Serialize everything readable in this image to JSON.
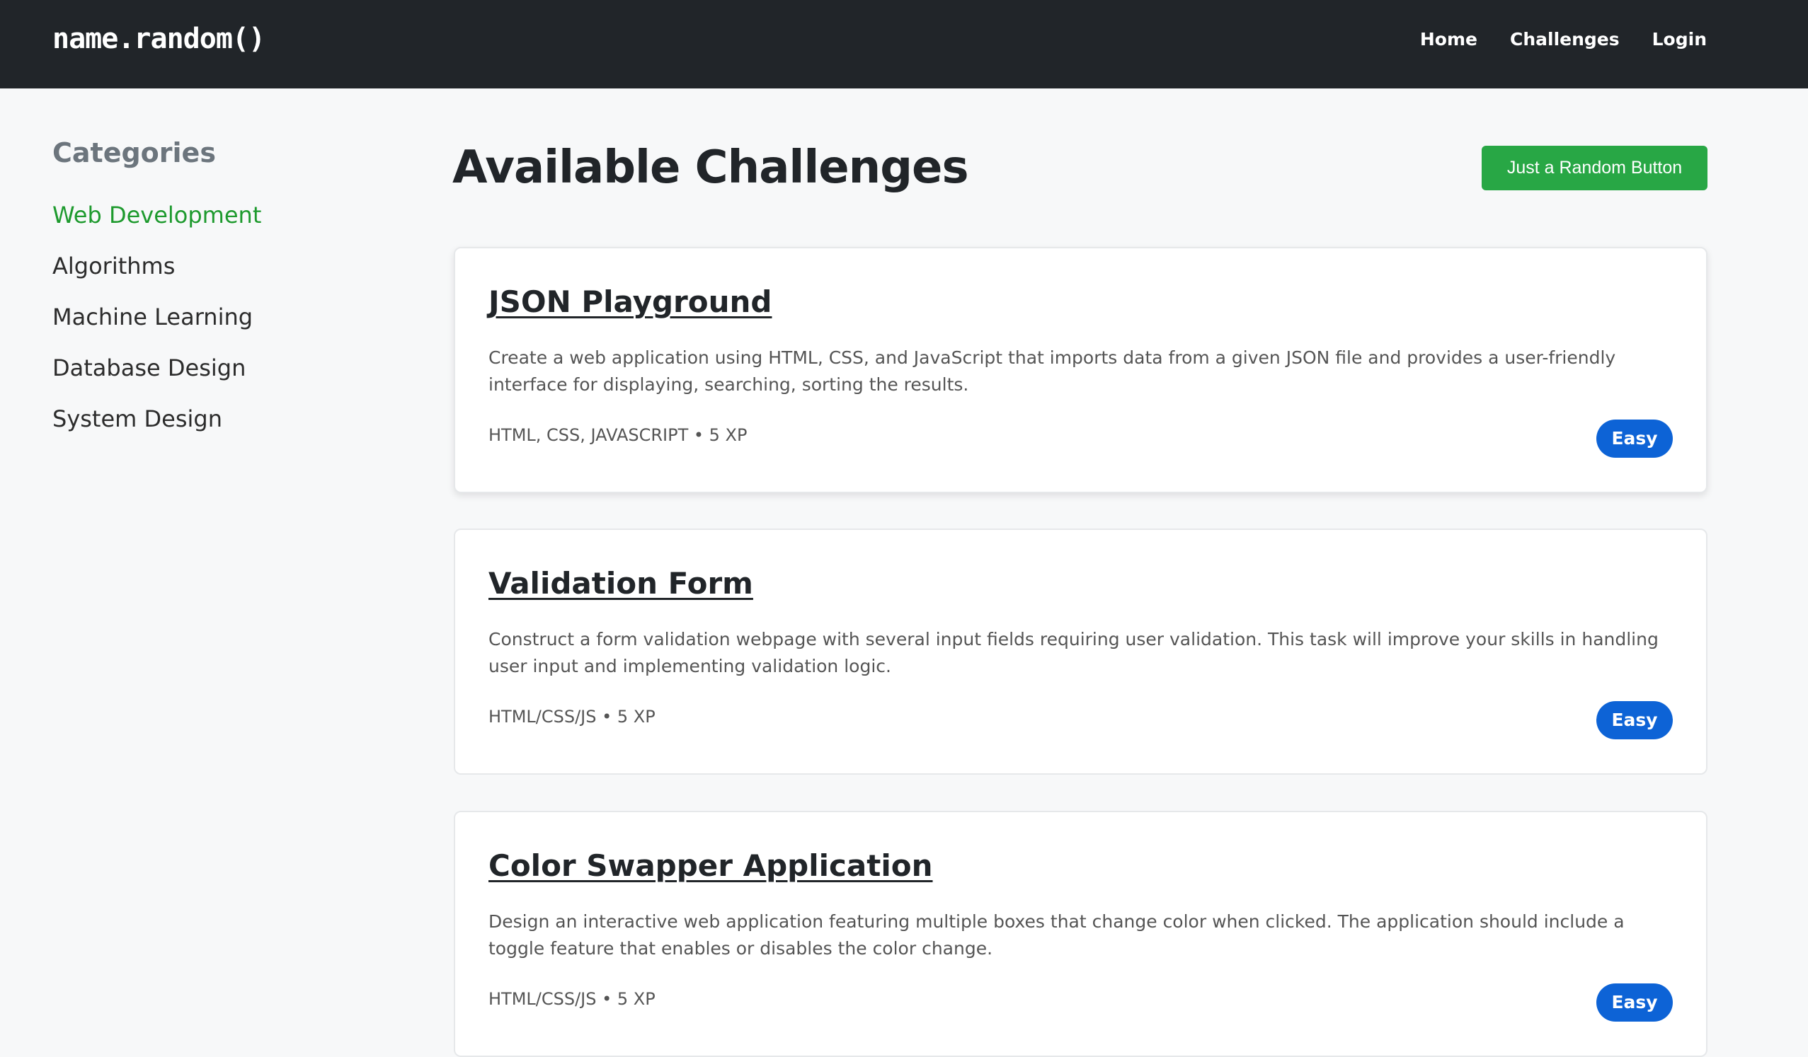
{
  "navbar": {
    "brand": "name.random()",
    "links": [
      {
        "label": "Home"
      },
      {
        "label": "Challenges"
      },
      {
        "label": "Login"
      }
    ]
  },
  "sidebar": {
    "heading": "Categories",
    "items": [
      {
        "label": "Web Development",
        "active": true
      },
      {
        "label": "Algorithms"
      },
      {
        "label": "Machine Learning"
      },
      {
        "label": "Database Design"
      },
      {
        "label": "System Design"
      }
    ]
  },
  "main": {
    "title": "Available Challenges",
    "random_button": "Just a Random Button",
    "challenges": [
      {
        "title": "JSON Playground",
        "description": "Create a web application using HTML, CSS, and JavaScript that imports data from a given JSON file and provides a user-friendly interface for displaying, searching, sorting the results.",
        "meta": "HTML, CSS, JAVASCRIPT • 5 XP",
        "difficulty": "Easy"
      },
      {
        "title": "Validation Form",
        "description": "Construct a form validation webpage with several input fields requiring user validation. This task will improve your skills in handling user input and implementing validation logic.",
        "meta": "HTML/CSS/JS • 5 XP",
        "difficulty": "Easy"
      },
      {
        "title": "Color Swapper Application",
        "description": "Design an interactive web application featuring multiple boxes that change color when clicked. The application should include a toggle feature that enables or disables the color change.",
        "meta": "HTML/CSS/JS • 5 XP",
        "difficulty": "Easy"
      }
    ]
  },
  "colors": {
    "navbar_bg": "#212529",
    "accent_green": "#28a745",
    "active_category": "#1e9a2e",
    "badge_blue": "#0d63d6"
  }
}
